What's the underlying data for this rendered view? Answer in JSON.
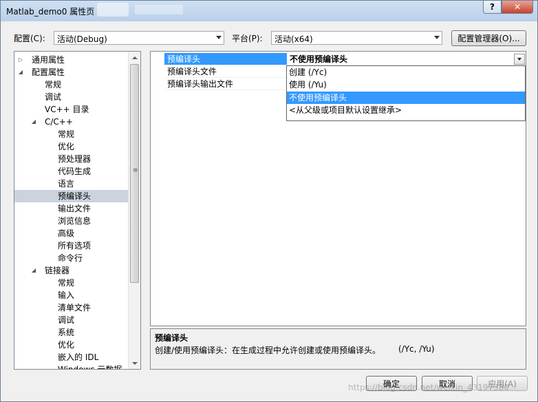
{
  "window": {
    "title": "Matlab_demo0 属性页",
    "help_label": "?",
    "close_label": "✕"
  },
  "toolbar": {
    "config_label": "配置(C):",
    "config_value": "活动(Debug)",
    "platform_label": "平台(P):",
    "platform_value": "活动(x64)",
    "config_manager_label": "配置管理器(O)..."
  },
  "tree": {
    "items": [
      {
        "label": "通用属性",
        "indent": 0,
        "expander": "▷"
      },
      {
        "label": "配置属性",
        "indent": 0,
        "expander": "◢"
      },
      {
        "label": "常规",
        "indent": 1
      },
      {
        "label": "调试",
        "indent": 1
      },
      {
        "label": "VC++ 目录",
        "indent": 1
      },
      {
        "label": "C/C++",
        "indent": 1,
        "expander": "◢"
      },
      {
        "label": "常规",
        "indent": 2
      },
      {
        "label": "优化",
        "indent": 2
      },
      {
        "label": "预处理器",
        "indent": 2
      },
      {
        "label": "代码生成",
        "indent": 2
      },
      {
        "label": "语言",
        "indent": 2
      },
      {
        "label": "预编译头",
        "indent": 2,
        "selected": true
      },
      {
        "label": "输出文件",
        "indent": 2
      },
      {
        "label": "浏览信息",
        "indent": 2
      },
      {
        "label": "高级",
        "indent": 2
      },
      {
        "label": "所有选项",
        "indent": 2
      },
      {
        "label": "命令行",
        "indent": 2
      },
      {
        "label": "链接器",
        "indent": 1,
        "expander": "◢"
      },
      {
        "label": "常规",
        "indent": 2
      },
      {
        "label": "输入",
        "indent": 2
      },
      {
        "label": "清单文件",
        "indent": 2
      },
      {
        "label": "调试",
        "indent": 2
      },
      {
        "label": "系统",
        "indent": 2
      },
      {
        "label": "优化",
        "indent": 2
      },
      {
        "label": "嵌入的 IDL",
        "indent": 2
      },
      {
        "label": "Windows 元数据",
        "indent": 2
      }
    ]
  },
  "grid": {
    "rows": [
      {
        "name": "预编译头",
        "value": "不使用预编译头",
        "selected": true
      },
      {
        "name": "预编译头文件",
        "value": ""
      },
      {
        "name": "预编译头输出文件",
        "value": ""
      }
    ]
  },
  "dropdown": {
    "options": [
      "创建 (/Yc)",
      "使用 (/Yu)",
      "不使用预编译头",
      "<从父级或项目默认设置继承>"
    ],
    "highlighted_index": 2
  },
  "description": {
    "title": "预编译头",
    "text": "创建/使用预编译头：在生成过程中允许创建或使用预编译头。",
    "flags": "(/Yc, /Yu)"
  },
  "buttons": {
    "ok": "确定",
    "cancel": "取消",
    "apply": "应用(A)"
  },
  "watermark": "https://blog.csdn.net/weixin_43197380"
}
